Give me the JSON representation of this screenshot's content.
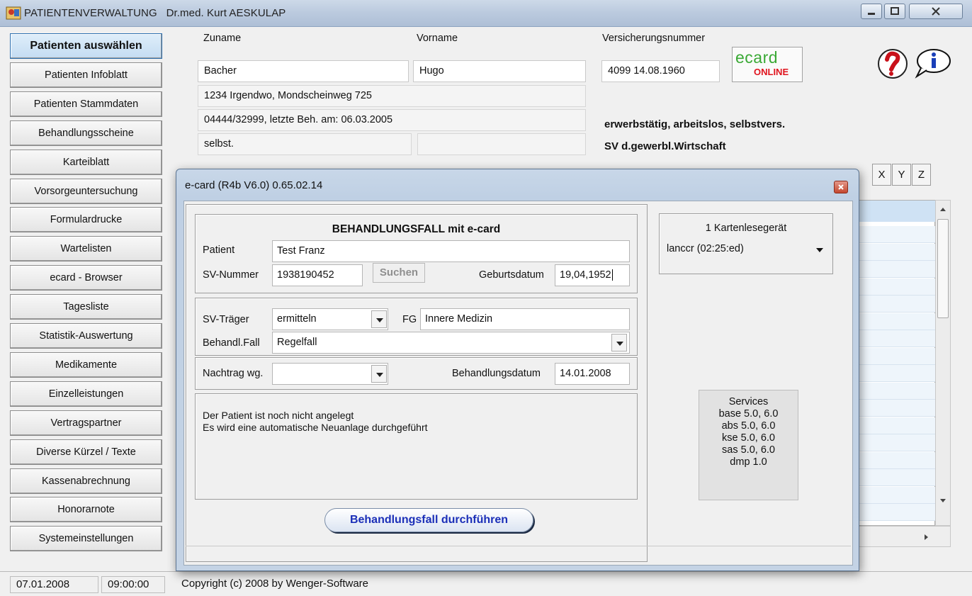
{
  "window": {
    "title": "PATIENTENVERWALTUNG",
    "doctor": "Dr.med. Kurt AESKULAP"
  },
  "sidebar": {
    "items": [
      {
        "label": "Patienten auswählen",
        "active": true
      },
      {
        "label": "Patienten Infoblatt"
      },
      {
        "label": "Patienten Stammdaten"
      },
      {
        "label": "Behandlungsscheine"
      },
      {
        "label": "Karteiblatt"
      },
      {
        "label": "Vorsorgeuntersuchung"
      },
      {
        "label": "Formulardrucke"
      },
      {
        "label": "Wartelisten"
      },
      {
        "label": "ecard - Browser"
      },
      {
        "label": "Tagesliste"
      },
      {
        "label": "Statistik-Auswertung"
      },
      {
        "label": "Medikamente"
      },
      {
        "label": "Einzelleistungen"
      },
      {
        "label": "Vertragspartner"
      },
      {
        "label": "Diverse Kürzel / Texte"
      },
      {
        "label": "Kassenabrechnung"
      },
      {
        "label": "Honorarnote"
      },
      {
        "label": "Systemeinstellungen"
      }
    ]
  },
  "patient": {
    "zuname_label": "Zuname",
    "zuname": "Bacher",
    "vorname_label": "Vorname",
    "vorname": "Hugo",
    "vsnr_label": "Versicherungsnummer",
    "vsnr": "4099 14.08.1960",
    "address": "1234  Irgendwo,  Mondscheinweg 725",
    "phone_line": "04444/32999,  letzte Beh. am: 06.03.2005",
    "status": "selbst.",
    "category": "erwerbstätig, arbeitslos, selbstvers.",
    "insurer": "SV d.gewerbl.Wirtschaft"
  },
  "ecard_logo": {
    "top": "ecard",
    "bottom": "ONLINE"
  },
  "letters": [
    "X",
    "Y",
    "Z"
  ],
  "statusbar": {
    "date": "07.01.2008",
    "time": "09:00:00",
    "copyright": "Copyright (c) 2008 by Wenger-Software"
  },
  "dialog": {
    "title": "e-card (R4b V6.0)  0.65.02.14",
    "heading": "BEHANDLUNGSFALL mit e-card",
    "patient_label": "Patient",
    "patient_value": "Test Franz",
    "svnr_label": "SV-Nummer",
    "svnr_value": "1938190452",
    "search_label": "Suchen",
    "birth_label": "Geburtsdatum",
    "birth_value": "19,04,1952",
    "svtraeger_label": "SV-Träger",
    "svtraeger_value": "ermitteln",
    "fg_label": "FG",
    "fg_value": "Innere Medizin",
    "fall_label": "Behandl.Fall",
    "fall_value": "Regelfall",
    "nachtrag_label": "Nachtrag wg.",
    "nachtrag_value": "",
    "bdate_label": "Behandlungsdatum",
    "bdate_value": "14.01.2008",
    "message_line1": "Der Patient  ist noch nicht angelegt",
    "message_line2": "Es wird eine automatische Neuanlage durchgeführt",
    "action_label": "Behandlungsfall durchführen",
    "reader_title": "1 Kartenlesegerät",
    "reader_value": "lanccr (02:25:ed)",
    "services": {
      "title": "Services",
      "lines": [
        "base  5.0, 6.0",
        "abs  5.0, 6.0",
        "kse  5.0, 6.0",
        "sas  5.0, 6.0",
        "dmp  1.0"
      ]
    }
  },
  "colors": {
    "accent": "#2b6fb0",
    "action_text": "#1b2fb8",
    "ecard_red": "#e0141e",
    "ecard_green": "#3aa935"
  }
}
